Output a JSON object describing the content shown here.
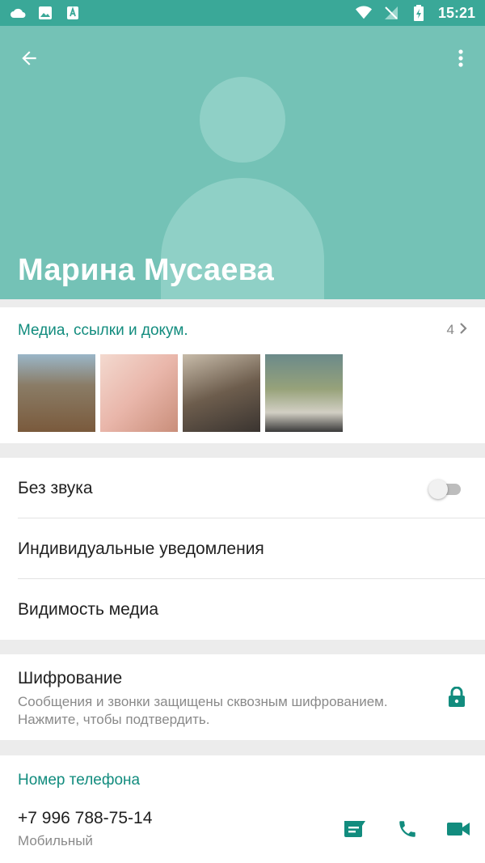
{
  "status_bar": {
    "time": "15:21",
    "icons": [
      "cloud-icon",
      "image-icon",
      "font-icon",
      "wifi-icon",
      "no-sim-icon",
      "battery-charging-icon"
    ]
  },
  "header": {
    "name": "Марина Мусаева",
    "back_icon": "arrow-back-icon",
    "menu_icon": "more-vert-icon",
    "avatar": "default-avatar"
  },
  "media": {
    "title": "Медиа, ссылки и докум.",
    "count": "4",
    "thumbnails": [
      "photo-1",
      "photo-2",
      "photo-3",
      "photo-4"
    ]
  },
  "settings": {
    "mute_label": "Без звука",
    "mute_on": false,
    "custom_notifications_label": "Индивидуальные уведомления",
    "media_visibility_label": "Видимость медиа"
  },
  "encryption": {
    "title": "Шифрование",
    "subtitle": "Сообщения и звонки защищены сквозным шифрованием. Нажмите, чтобы подтвердить."
  },
  "phone": {
    "title": "Номер телефона",
    "number": "+7 996 788-75-14",
    "type": "Мобильный"
  },
  "colors": {
    "status_bar": "#3aa898",
    "header": "#74c2b6",
    "accent": "#128c7e"
  }
}
